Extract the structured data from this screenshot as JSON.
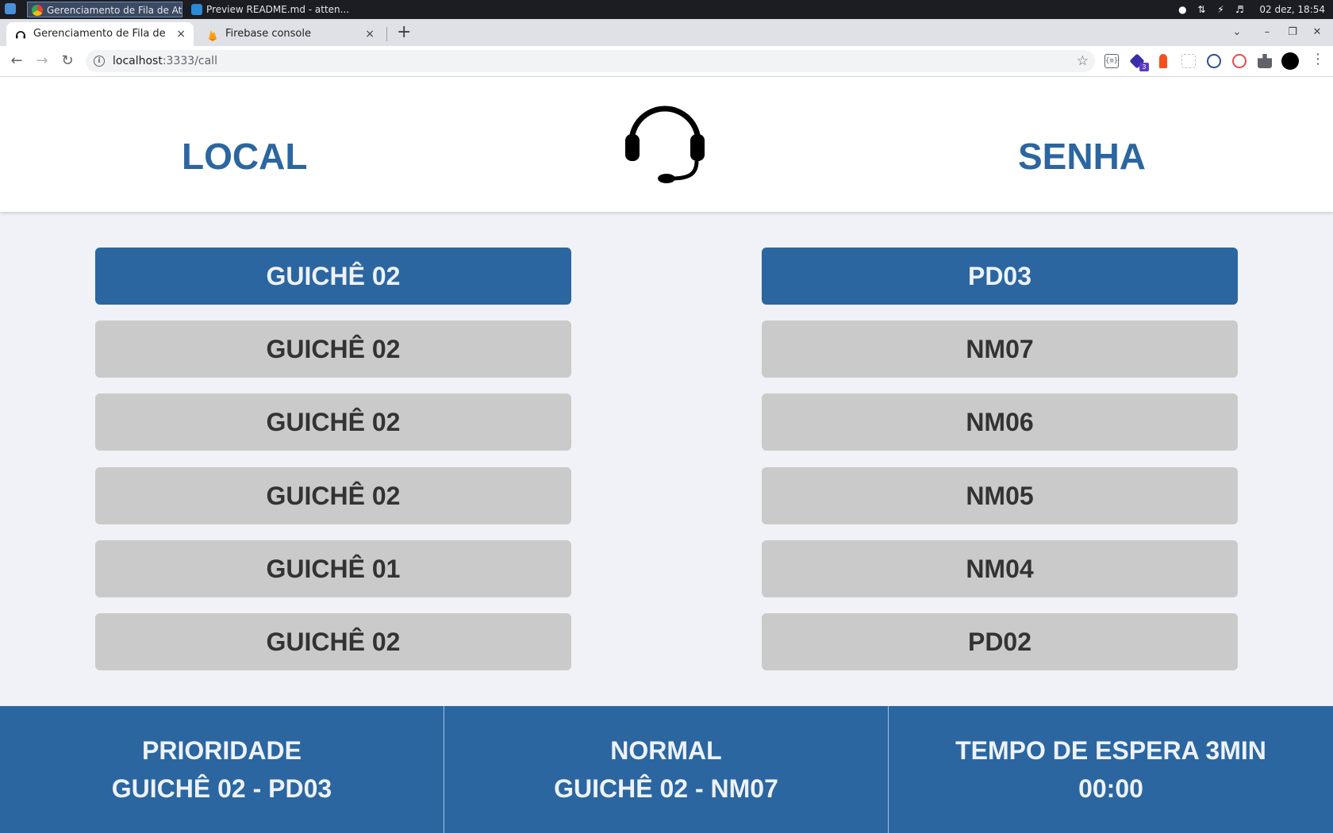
{
  "taskbar": {
    "tasks": [
      {
        "label": "Gerenciamento de Fila de At..."
      },
      {
        "label": "Preview README.md - atten..."
      }
    ],
    "clock": "02 dez, 18:54"
  },
  "browser": {
    "tabs": [
      {
        "title": "Gerenciamento de Fila de Atendimento",
        "close": "×"
      },
      {
        "title": "Firebase console",
        "close": "×"
      }
    ],
    "new_tab": "+",
    "url_host": "localhost",
    "url_path": ":3333/call",
    "extensions": [
      "json-viewer-icon",
      "shield-badge-icon",
      "lighthouse-icon",
      "grid-icon",
      "block-icon",
      "no-tracking-icon",
      "puzzle-icon",
      "profile-avatar"
    ],
    "extension_badge": "3"
  },
  "header": {
    "left_title": "LOCAL",
    "right_title": "SENHA",
    "center_icon": "headset-icon"
  },
  "calls": [
    {
      "local": "GUICHÊ 02",
      "senha": "PD03",
      "current": true
    },
    {
      "local": "GUICHÊ 02",
      "senha": "NM07",
      "current": false
    },
    {
      "local": "GUICHÊ 02",
      "senha": "NM06",
      "current": false
    },
    {
      "local": "GUICHÊ 02",
      "senha": "NM05",
      "current": false
    },
    {
      "local": "GUICHÊ 01",
      "senha": "NM04",
      "current": false
    },
    {
      "local": "GUICHÊ 02",
      "senha": "PD02",
      "current": false
    }
  ],
  "footer": {
    "prioridade": {
      "label": "PRIORIDADE",
      "value": "GUICHÊ 02 - PD03"
    },
    "normal": {
      "label": "NORMAL",
      "value": "GUICHÊ 02 - NM07"
    },
    "espera": {
      "label": "TEMPO DE ESPERA 3MIN",
      "value": "00:00"
    }
  },
  "colors": {
    "primary": "#2b66a0",
    "past_card": "#cacaca",
    "page_bg": "#f0f2f7"
  }
}
